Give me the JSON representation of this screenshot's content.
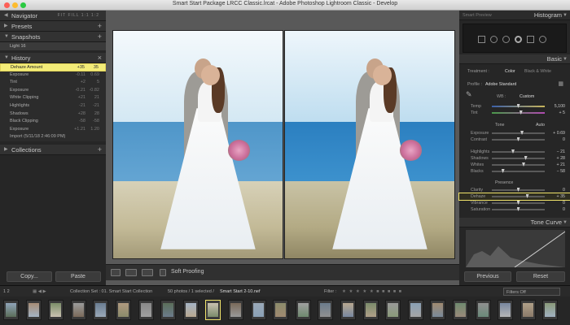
{
  "window": {
    "title": "Smart Start Package LRCC Classic.lrcat - Adobe Photoshop Lightroom Classic - Develop"
  },
  "left_panel": {
    "navigator": {
      "label": "Navigator",
      "modes": "FIT FILL 1:1 1:2"
    },
    "presets": {
      "label": "Presets",
      "action": "+"
    },
    "snapshots": {
      "label": "Snapshots",
      "action": "+",
      "items": [
        "Light 16"
      ]
    },
    "history": {
      "label": "History",
      "action": "×",
      "items": [
        {
          "name": "Dehaze Amount",
          "from": "+35",
          "to": "35"
        },
        {
          "name": "Exposure",
          "from": "-0.11",
          "to": "0.69"
        },
        {
          "name": "Tint",
          "from": "+2",
          "to": "5"
        },
        {
          "name": "Exposure",
          "from": "-0.21",
          "to": "-0.82"
        },
        {
          "name": "White Clipping",
          "from": "+21",
          "to": "21"
        },
        {
          "name": "Highlights",
          "from": "-21",
          "to": "-21"
        },
        {
          "name": "Shadows",
          "from": "+28",
          "to": "28"
        },
        {
          "name": "Black Clipping",
          "from": "-58",
          "to": "-58"
        },
        {
          "name": "Exposure",
          "from": "+1.21",
          "to": "1.20"
        },
        {
          "name": "Import (5/11/18 2:46:09 PM)",
          "from": "",
          "to": ""
        }
      ]
    },
    "collections": {
      "label": "Collections",
      "action": "+"
    },
    "buttons": {
      "copy": "Copy...",
      "paste": "Paste"
    }
  },
  "toolbar": {
    "soft_proofing": "Soft Proofing"
  },
  "right_panel": {
    "smart_preview": "Smart Preview",
    "histogram": "Histogram",
    "basic": "Basic",
    "treatment_label": "Treatment :",
    "treatment_color": "Color",
    "treatment_bw": "Black & White",
    "profile_label": "Profile :",
    "profile_value": "Adobe Standard",
    "wb_label": "WB :",
    "wb_value": "Custom",
    "tone_label": "Tone",
    "tone_auto": "Auto",
    "presence_label": "Presence",
    "sliders": [
      {
        "name": "Temp",
        "value": "5,100",
        "pos": 0.5
      },
      {
        "name": "Tint",
        "value": "+ 5",
        "pos": 0.55
      },
      {
        "name": "Exposure",
        "value": "+ 0.69",
        "pos": 0.57
      },
      {
        "name": "Contrast",
        "value": "0",
        "pos": 0.5
      },
      {
        "name": "Highlights",
        "value": "− 21",
        "pos": 0.4
      },
      {
        "name": "Shadows",
        "value": "+ 28",
        "pos": 0.64
      },
      {
        "name": "Whites",
        "value": "+ 21",
        "pos": 0.6
      },
      {
        "name": "Blacks",
        "value": "− 58",
        "pos": 0.21
      },
      {
        "name": "Clarity",
        "value": "0",
        "pos": 0.5
      },
      {
        "name": "Dehaze",
        "value": "+ 35",
        "pos": 0.67
      },
      {
        "name": "Vibrance",
        "value": "0",
        "pos": 0.5
      },
      {
        "name": "Saturation",
        "value": "0",
        "pos": 0.5
      }
    ],
    "tone_curve": "Tone Curve",
    "buttons": {
      "previous": "Previous",
      "reset": "Reset"
    }
  },
  "filmbar": {
    "pages": "1 2",
    "collection": "Collection Set : 01. Smart Start Collection",
    "count": "50 photos / 1 selected /",
    "file": "Smart Start 2-10.nef",
    "filter_label": "Filter :",
    "filters_off": "Filters Off"
  },
  "colors": {
    "accent_yellow": "#f3ec78",
    "panel_bg": "#262626",
    "center_bg": "#595959"
  }
}
